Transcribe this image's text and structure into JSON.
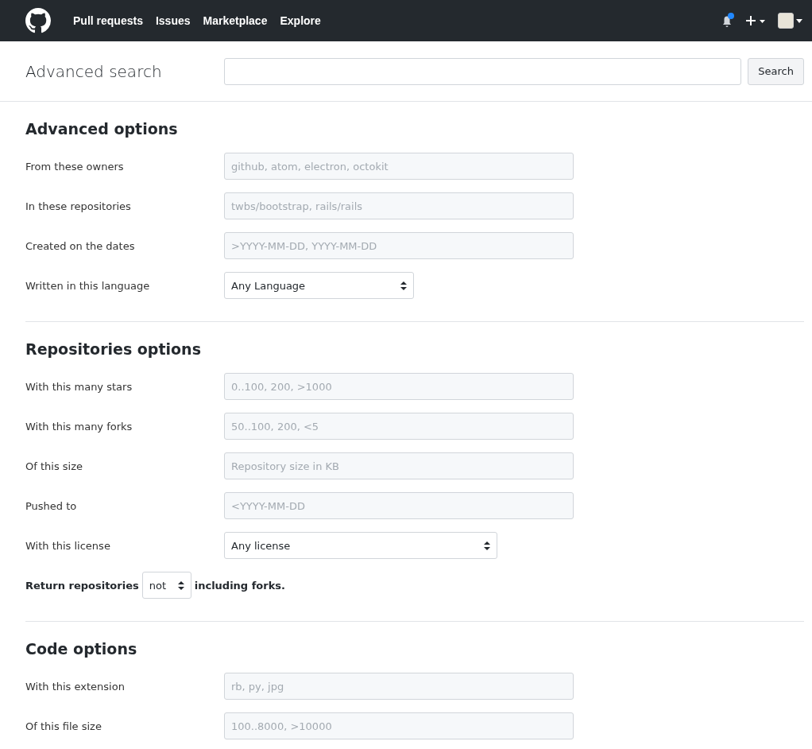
{
  "nav": {
    "links": [
      "Pull requests",
      "Issues",
      "Marketplace",
      "Explore"
    ]
  },
  "search": {
    "title": "Advanced search",
    "button": "Search"
  },
  "sections": [
    {
      "title": "Advanced options",
      "fields": [
        {
          "kind": "text",
          "label": "From these owners",
          "placeholder": "github, atom, electron, octokit"
        },
        {
          "kind": "text",
          "label": "In these repositories",
          "placeholder": "twbs/bootstrap, rails/rails"
        },
        {
          "kind": "text",
          "label": "Created on the dates",
          "placeholder": ">YYYY-MM-DD, YYYY-MM-DD"
        },
        {
          "kind": "select",
          "label": "Written in this language",
          "value": "Any Language"
        }
      ]
    },
    {
      "title": "Repositories options",
      "fields": [
        {
          "kind": "text",
          "label": "With this many stars",
          "placeholder": "0..100, 200, >1000"
        },
        {
          "kind": "text",
          "label": "With this many forks",
          "placeholder": "50..100, 200, <5"
        },
        {
          "kind": "text",
          "label": "Of this size",
          "placeholder": "Repository size in KB"
        },
        {
          "kind": "text",
          "label": "Pushed to",
          "placeholder": "<YYYY-MM-DD"
        },
        {
          "kind": "select",
          "label": "With this license",
          "value": "Any license"
        },
        {
          "kind": "sentence",
          "before": "Return repositories",
          "value": "not",
          "after": "including forks."
        }
      ]
    },
    {
      "title": "Code options",
      "fields": [
        {
          "kind": "text",
          "label": "With this extension",
          "placeholder": "rb, py, jpg"
        },
        {
          "kind": "text",
          "label": "Of this file size",
          "placeholder": "100..8000, >10000"
        }
      ]
    }
  ]
}
